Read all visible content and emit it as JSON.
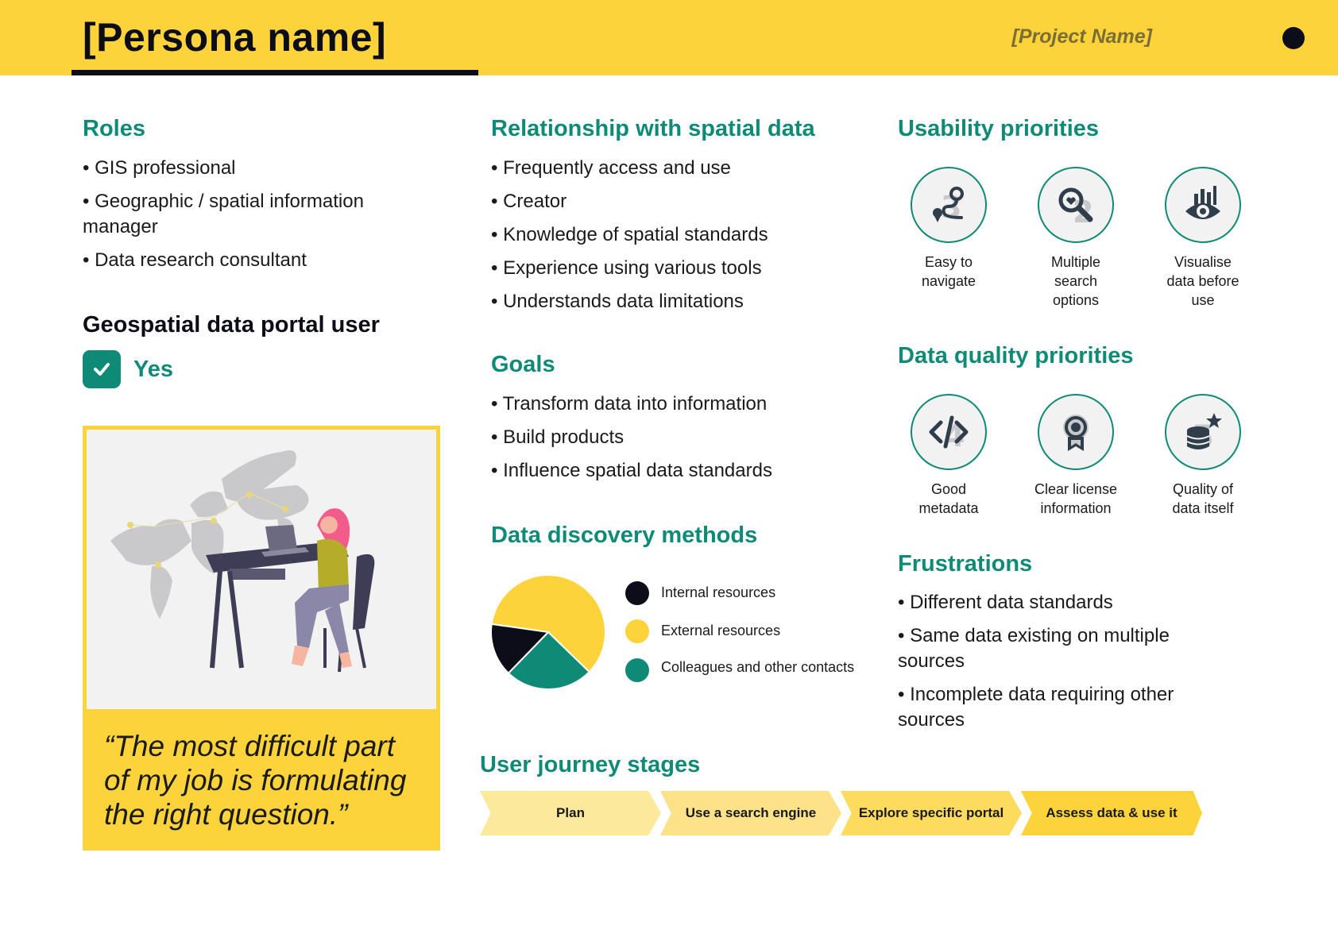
{
  "header": {
    "title": "[Persona name]",
    "project_name": "[Project Name]"
  },
  "roles": {
    "title": "Roles",
    "items": [
      "• GIS professional",
      "• Geographic / spatial information manager",
      "• Data research consultant"
    ]
  },
  "portal_user": {
    "title": "Geospatial data portal user",
    "value": "Yes"
  },
  "quote": "“The most difficult part of my job is formulating the right question.”",
  "relationship": {
    "title": "Relationship with spatial data",
    "items": [
      "• Frequently access and use",
      "• Creator",
      "• Knowledge of spatial standards",
      "• Experience using various tools",
      "• Understands data limitations"
    ]
  },
  "goals": {
    "title": "Goals",
    "items": [
      "• Transform data into information",
      "• Build products",
      "• Influence spatial data standards"
    ]
  },
  "discovery": {
    "title": "Data discovery methods",
    "legend": [
      "Internal resources",
      "External resources",
      "Colleagues and other contacts"
    ]
  },
  "chart_data": {
    "type": "pie",
    "categories": [
      "Internal resources",
      "External resources",
      "Colleagues and other contacts"
    ],
    "values": [
      15,
      60,
      25
    ],
    "colors": [
      "#0d0d1a",
      "#fcd33b",
      "#0f8a76"
    ]
  },
  "usability": {
    "title": "Usability priorities",
    "items": [
      {
        "icon": "route-pin-icon",
        "label": "Easy to navigate"
      },
      {
        "icon": "magnifier-icon",
        "label": "Multiple search options"
      },
      {
        "icon": "eye-chart-icon",
        "label": "Visualise data before use"
      }
    ]
  },
  "quality": {
    "title": "Data quality priorities",
    "items": [
      {
        "icon": "code-icon",
        "label": "Good metadata"
      },
      {
        "icon": "award-ribbon-icon",
        "label": "Clear license information"
      },
      {
        "icon": "database-star-icon",
        "label": "Quality of data itself"
      }
    ]
  },
  "frustrations": {
    "title": "Frustrations",
    "items": [
      "• Different data standards",
      "• Same data existing on multiple sources",
      "• Incomplete data requiring other sources"
    ]
  },
  "journey": {
    "title": "User journey stages",
    "stages": [
      "Plan",
      "Use a search engine",
      "Explore specific portal",
      "Assess data & use it"
    ],
    "colors": [
      "#fde99b",
      "#fde28a",
      "#fddb5e",
      "#fcd33b"
    ]
  },
  "colors": {
    "accent_teal": "#0f8a76",
    "accent_yellow": "#fcd33b",
    "dark": "#0d0d1a"
  }
}
